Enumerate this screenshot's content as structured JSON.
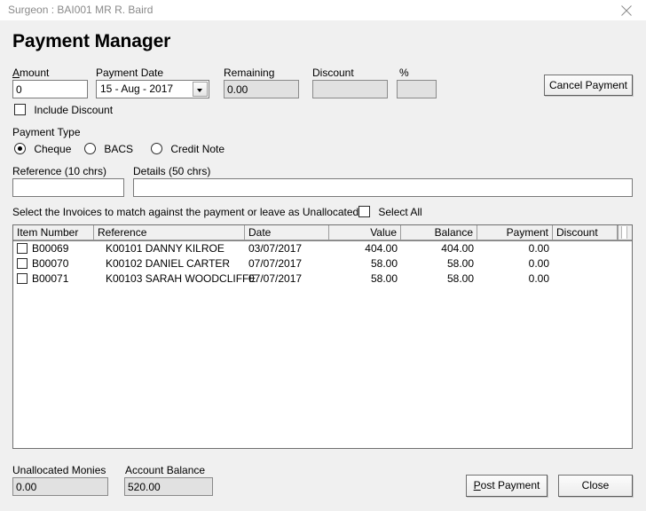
{
  "window": {
    "title": "Surgeon : BAI001 MR R. Baird",
    "close_icon": "close-icon"
  },
  "page": {
    "title": "Payment Manager"
  },
  "form": {
    "amount": {
      "label": "Amount",
      "accel": "A",
      "value": "0"
    },
    "payment_date": {
      "label": "Payment Date",
      "value": "15 - Aug - 2017"
    },
    "remaining": {
      "label": "Remaining",
      "value": "0.00"
    },
    "discount": {
      "label": "Discount",
      "value": ""
    },
    "percent": {
      "label": "%",
      "value": ""
    },
    "include_discount": {
      "label": "Include Discount",
      "checked": false
    },
    "cancel_payment": {
      "label": "Cancel Payment"
    }
  },
  "payment_type": {
    "label": "Payment Type",
    "options": [
      {
        "label": "Cheque",
        "selected": true
      },
      {
        "label": "BACS",
        "selected": false
      },
      {
        "label": "Credit Note",
        "selected": false
      }
    ]
  },
  "reference": {
    "label": "Reference (10 chrs)",
    "value": ""
  },
  "details": {
    "label": "Details (50 chrs)",
    "value": ""
  },
  "invoices": {
    "instruction": "Select the Invoices to match against the payment or leave as Unallocated",
    "select_all": {
      "label": "Select All",
      "checked": false
    },
    "columns": [
      "Item Number",
      "Reference",
      "Date",
      "Value",
      "Balance",
      "Payment",
      "Discount"
    ],
    "rows": [
      {
        "checked": false,
        "item_number": "B00069",
        "reference": "K00101 DANNY KILROE",
        "date": "03/07/2017",
        "value": "404.00",
        "balance": "404.00",
        "payment": "0.00",
        "discount": ""
      },
      {
        "checked": false,
        "item_number": "B00070",
        "reference": "K00102 DANIEL CARTER",
        "date": "07/07/2017",
        "value": "58.00",
        "balance": "58.00",
        "payment": "0.00",
        "discount": ""
      },
      {
        "checked": false,
        "item_number": "B00071",
        "reference": "K00103 SARAH WOODCLIFFE",
        "date": "07/07/2017",
        "value": "58.00",
        "balance": "58.00",
        "payment": "0.00",
        "discount": ""
      }
    ]
  },
  "footer": {
    "unallocated_monies": {
      "label": "Unallocated Monies",
      "value": "0.00"
    },
    "account_balance": {
      "label": "Account Balance",
      "value": "520.00"
    },
    "post_payment": {
      "label": "Post Payment",
      "accel": "P"
    },
    "close": {
      "label": "Close"
    }
  },
  "colors": {
    "window_bg": "#f0f0f0",
    "titlebar_bg": "#ffffff",
    "titlebar_text": "#8a8a8a",
    "field_bg": "#ffffff",
    "readonly_bg": "#e1e1e1",
    "border": "#7a7a7a"
  }
}
